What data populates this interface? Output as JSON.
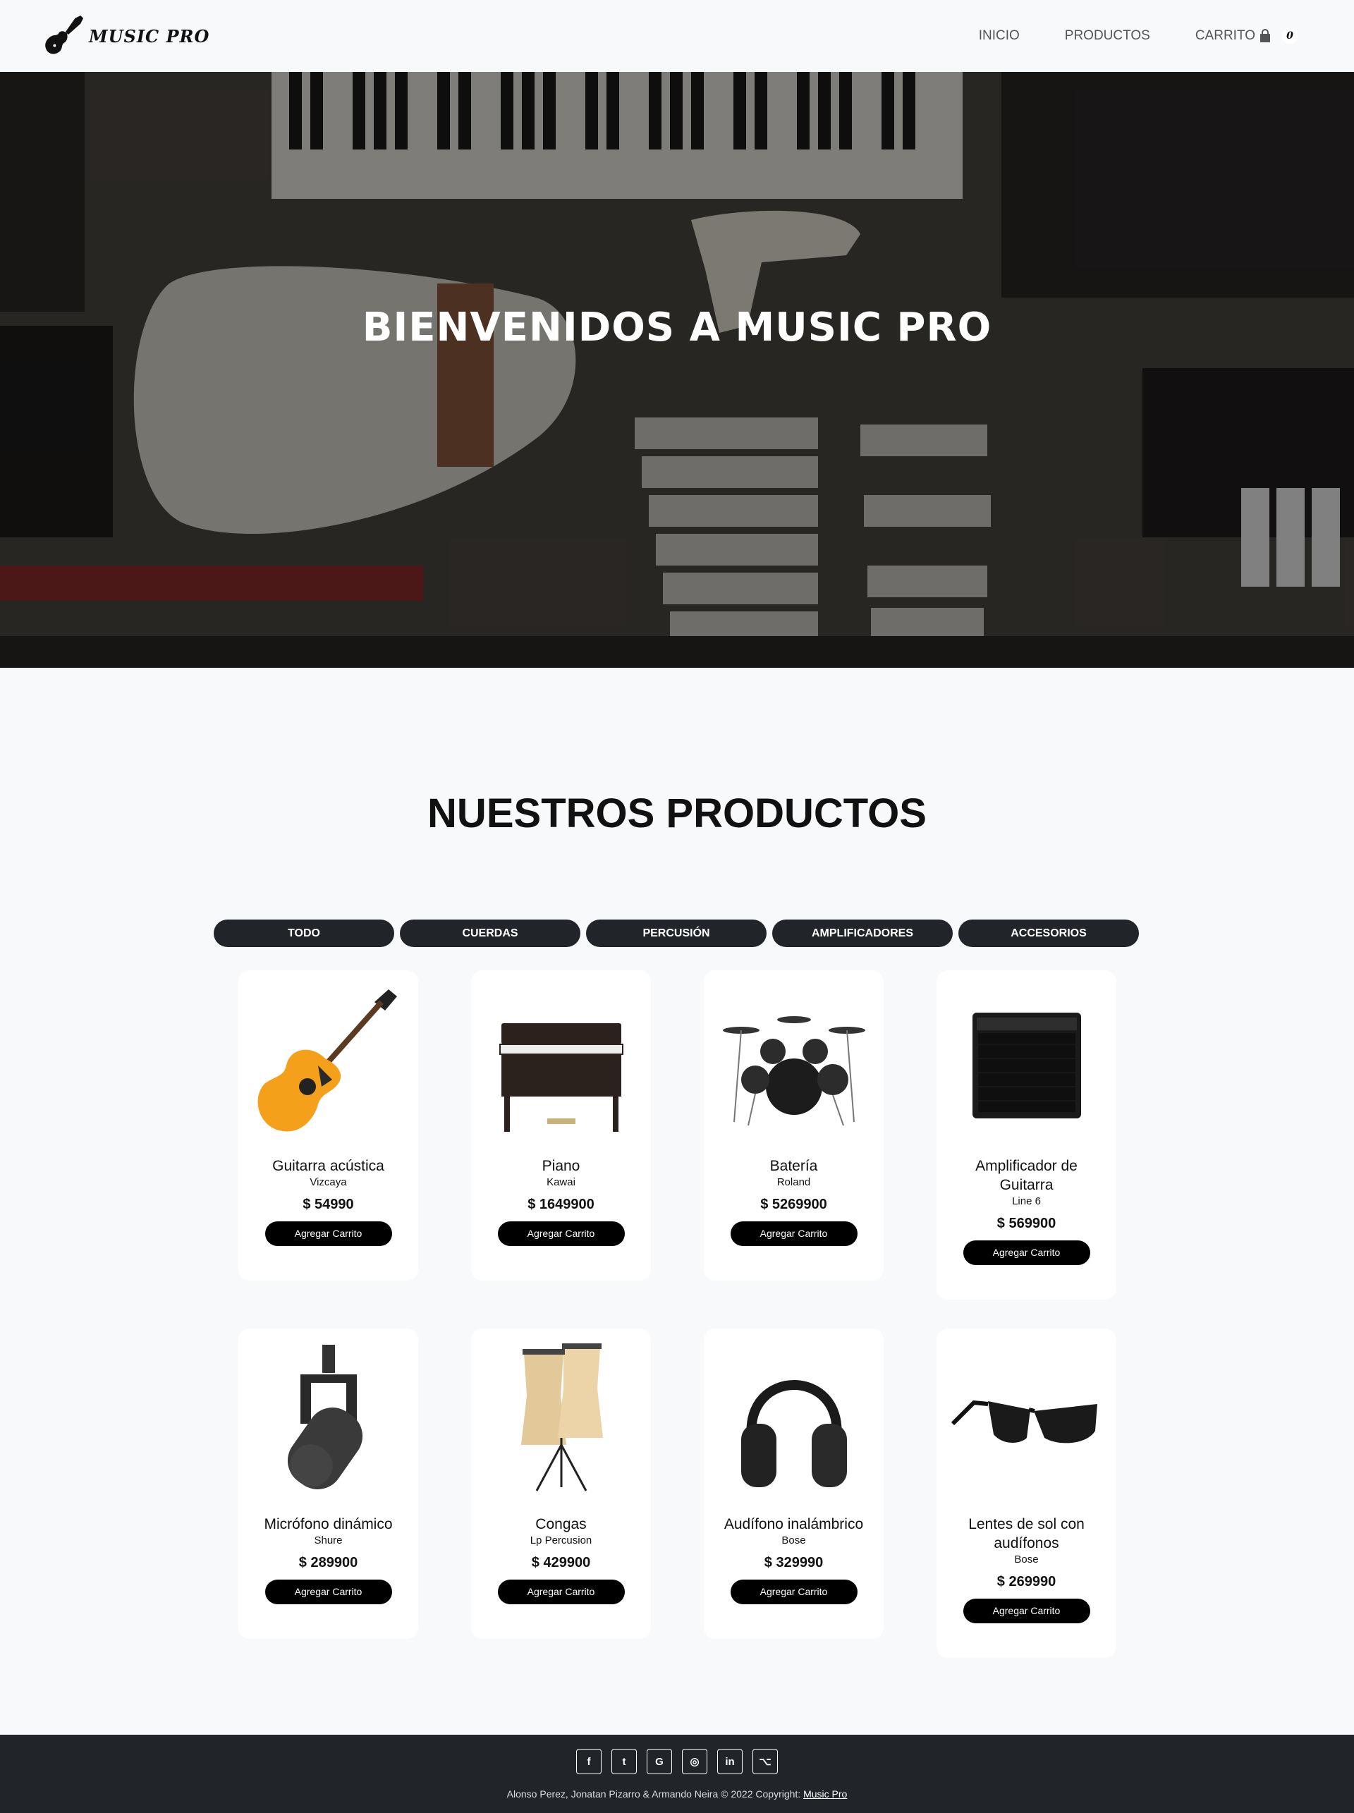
{
  "navbar": {
    "brand": "MUSIC PRO",
    "links": [
      "INICIO",
      "PRODUCTOS",
      "CARRITO"
    ],
    "cart_count": "0"
  },
  "hero": {
    "title": "BIENVENIDOS A MUSIC PRO"
  },
  "products_section": {
    "title": "NUESTROS PRODUCTOS",
    "filters": [
      "TODO",
      "CUERDAS",
      "PERCUSIÓN",
      "AMPLIFICADORES",
      "ACCESORIOS"
    ],
    "add_label": "Agregar Carrito",
    "items": [
      {
        "name": "Guitarra acústica",
        "brand": "Vizcaya",
        "price": "$ 54990",
        "icon": "guitar-icon"
      },
      {
        "name": "Piano",
        "brand": "Kawai",
        "price": "$ 1649900",
        "icon": "piano-icon"
      },
      {
        "name": "Batería",
        "brand": "Roland",
        "price": "$ 5269900",
        "icon": "drums-icon"
      },
      {
        "name": "Amplificador de Guitarra",
        "brand": "Line 6",
        "price": "$ 569900",
        "icon": "amplifier-icon"
      },
      {
        "name": "Micrófono dinámico",
        "brand": "Shure",
        "price": "$ 289900",
        "icon": "microphone-icon"
      },
      {
        "name": "Congas",
        "brand": "Lp Percusion",
        "price": "$ 429900",
        "icon": "congas-icon"
      },
      {
        "name": "Audífono inalámbrico",
        "brand": "Bose",
        "price": "$ 329990",
        "icon": "headphones-icon"
      },
      {
        "name": "Lentes de sol con audífonos",
        "brand": "Bose",
        "price": "$ 269990",
        "icon": "sunglasses-icon"
      }
    ]
  },
  "footer": {
    "socials": [
      "facebook-icon",
      "twitter-icon",
      "google-icon",
      "instagram-icon",
      "linkedin-icon",
      "github-icon"
    ],
    "social_glyphs": [
      "f",
      "t",
      "G",
      "◎",
      "in",
      "⌥"
    ],
    "copyright": "Alonso Perez, Jonatan Pizarro & Armando Neira © 2022 Copyright: ",
    "copyright_link": "Music Pro"
  },
  "colors": {
    "dark": "#212529",
    "background": "#f8f9fa",
    "guitar_body": "#f5a01a"
  }
}
